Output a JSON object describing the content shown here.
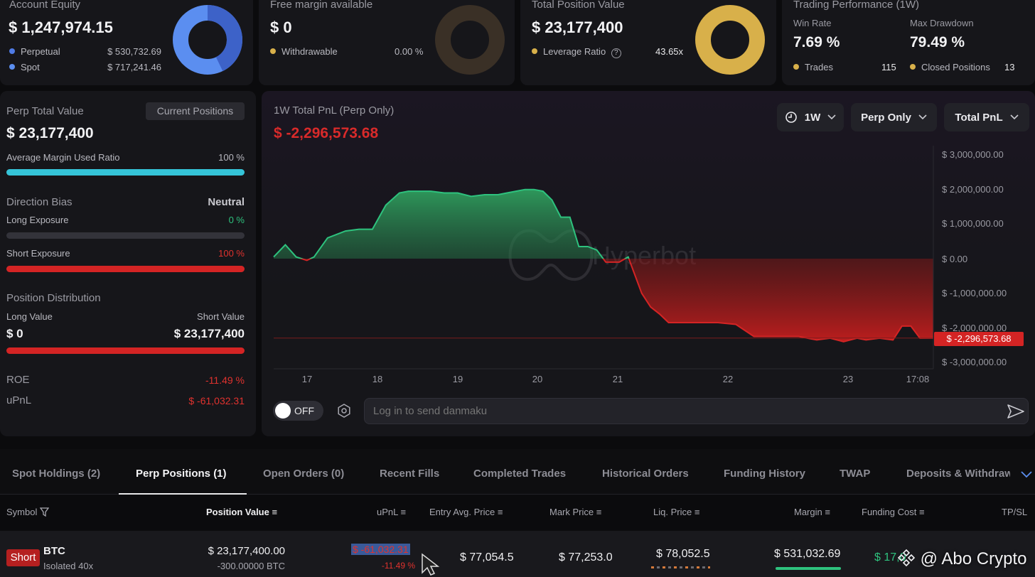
{
  "summary": {
    "equity": {
      "title": "Account Equity",
      "value": "$ 1,247,974.15",
      "rows": [
        {
          "label": "Perpetual",
          "value": "$ 530,732.69"
        },
        {
          "label": "Spot",
          "value": "$ 717,241.46"
        }
      ]
    },
    "margin": {
      "title": "Free margin available",
      "value": "$ 0",
      "row_label": "Withdrawable",
      "row_value": "0.00 %"
    },
    "position": {
      "title": "Total Position Value",
      "value": "$ 23,177,400",
      "row_label": "Leverage Ratio",
      "row_value": "43.65x"
    },
    "performance": {
      "title": "Trading Performance (1W)",
      "win_rate_label": "Win Rate",
      "win_rate": "7.69 %",
      "drawdown_label": "Max Drawdown",
      "drawdown": "79.49 %",
      "trades_label": "Trades",
      "trades": "115",
      "closed_label": "Closed Positions",
      "closed": "13"
    }
  },
  "perp": {
    "title": "Perp Total Value",
    "button": "Current Positions",
    "value": "$ 23,177,400",
    "margin_label": "Average Margin Used Ratio",
    "margin_value": "100 %",
    "margin_fill": 1.0,
    "bias_label": "Direction Bias",
    "bias_value": "Neutral",
    "long_label": "Long Exposure",
    "long_value": "0 %",
    "long_fill": 0.0,
    "short_label": "Short Exposure",
    "short_value": "100 %",
    "short_fill": 1.0,
    "dist_label": "Position Distribution",
    "long_value_label": "Long Value",
    "short_value_label": "Short Value",
    "long_amount": "$ 0",
    "short_amount": "$ 23,177,400",
    "roe_label": "ROE",
    "roe": "-11.49 %",
    "upnl_label": "uPnL",
    "upnl": "$ -61,032.31"
  },
  "pnl": {
    "title": "1W Total PnL (Perp Only)",
    "value": "$ -2,296,573.68",
    "controls": {
      "period": "1W",
      "scope": "Perp Only",
      "metric": "Total PnL"
    },
    "watermark": "Hyperbot",
    "current_label": "$ -2,296,573.68",
    "toggle": "OFF",
    "danmaku_placeholder": "Log in to send danmaku"
  },
  "chart_data": {
    "type": "area",
    "title": "1W Total PnL (Perp Only)",
    "x_tick_labels": [
      "17",
      "18",
      "19",
      "20",
      "21",
      "22",
      "23",
      "17:08"
    ],
    "y_tick_labels": [
      "$ 3,000,000.00",
      "$ 2,000,000.00",
      "$ 1,000,000.00",
      "$ 0.00",
      "$ -1,000,000.00",
      "$ -2,000,000.00",
      "$ -3,000,000.00"
    ],
    "ylim": [
      -3000000,
      3000000
    ],
    "xlim": [
      16.55,
      23.9
    ],
    "x": [
      16.55,
      16.68,
      16.8,
      16.92,
      17.0,
      17.15,
      17.35,
      17.5,
      17.65,
      17.8,
      17.95,
      18.05,
      18.15,
      18.3,
      18.45,
      18.6,
      18.75,
      18.9,
      19.05,
      19.15,
      19.25,
      19.35,
      19.45,
      19.55,
      19.65,
      19.75,
      19.85,
      19.95,
      20.05,
      20.15,
      20.25,
      20.4,
      20.5,
      20.65,
      20.75,
      20.85,
      20.95,
      21.1,
      21.3,
      21.5,
      21.7,
      21.9,
      22.0,
      22.2,
      22.4,
      22.6,
      22.75,
      22.9,
      23.05,
      23.15,
      23.3,
      23.45,
      23.55,
      23.65,
      23.75,
      23.9
    ],
    "y": [
      50000,
      400000,
      50000,
      -50000,
      50000,
      600000,
      800000,
      850000,
      850000,
      1550000,
      1900000,
      1950000,
      1950000,
      1950000,
      1900000,
      1900000,
      1800000,
      1850000,
      1850000,
      1900000,
      1950000,
      2000000,
      2000000,
      1950000,
      1700000,
      1200000,
      1200000,
      350000,
      350000,
      250000,
      -100000,
      -100000,
      50000,
      -1000000,
      -1400000,
      -1600000,
      -1850000,
      -1850000,
      -1850000,
      -1850000,
      -1900000,
      -2250000,
      -2250000,
      -2250000,
      -2250000,
      -2350000,
      -2300000,
      -2400000,
      -2300000,
      -2350000,
      -2300000,
      -2350000,
      -1950000,
      -1950000,
      -2300000,
      -2296573.68
    ]
  },
  "tabs": [
    "Spot Holdings (2)",
    "Perp Positions (1)",
    "Open Orders (0)",
    "Recent Fills",
    "Completed Trades",
    "Historical Orders",
    "Funding History",
    "TWAP",
    "Deposits & Withdraw"
  ],
  "table": {
    "headers": [
      "Symbol",
      "Position Value",
      "uPnL",
      "Entry Avg. Price",
      "Mark Price",
      "Liq. Price",
      "Margin",
      "Funding Cost",
      "TP/SL"
    ],
    "row": {
      "side": "Short",
      "symbol": "BTC",
      "mode": "Isolated 40x",
      "position_value": "$ 23,177,400.00",
      "position_size": "-300.00000 BTC",
      "upnl": "$ -61,032.31",
      "upnl_pct": "-11.49 %",
      "entry": "$ 77,054.5",
      "mark": "$ 77,253.0",
      "liq": "$ 78,052.5",
      "margin": "$ 531,032.69",
      "funding": "$ 17,0"
    }
  },
  "watermark_text": "@ Abo Crypto",
  "colors": {
    "blue": "#4f7be6",
    "gold": "#d8b04a",
    "cyan": "#35c4d8",
    "red": "#e0322e",
    "green": "#2ec27e"
  }
}
